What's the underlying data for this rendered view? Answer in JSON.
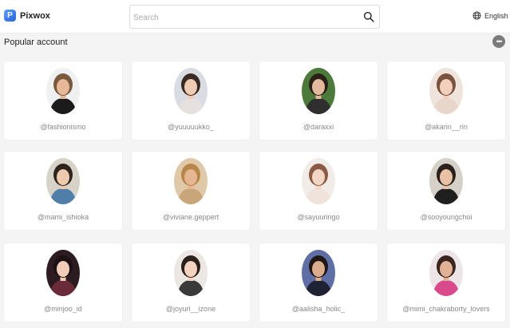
{
  "app": {
    "logo_letter": "P",
    "name": "Pixwox"
  },
  "search": {
    "placeholder": "Search",
    "value": "",
    "icon": "search-icon"
  },
  "language": {
    "label": "English",
    "icon": "globe-icon"
  },
  "section": {
    "title": "Popular account",
    "more_icon": "more-horizontal-icon",
    "more_label": "•••"
  },
  "accounts": [
    {
      "handle": "@fashionismo",
      "bg": "#eef0f2",
      "skin": "#e7b79a",
      "hair": "#7a5a3c",
      "cloth": "#1b1b1b"
    },
    {
      "handle": "@yuuuuukko_",
      "bg": "#d9dde3",
      "skin": "#f0cbb3",
      "hair": "#3a2b22",
      "cloth": "#e6e1de"
    },
    {
      "handle": "@daraxxi",
      "bg": "#4b7a3a",
      "skin": "#e2b99c",
      "hair": "#2b2018",
      "cloth": "#2f2f2f"
    },
    {
      "handle": "@akarin__rin",
      "bg": "#efe4dc",
      "skin": "#f3d0bc",
      "hair": "#7a5240",
      "cloth": "#e8d6ca"
    },
    {
      "handle": "@mami_ishioka",
      "bg": "#d7d3c8",
      "skin": "#edc9ae",
      "hair": "#2e241d",
      "cloth": "#4f7ea8"
    },
    {
      "handle": "@viviane.geppert",
      "bg": "#e0c9a8",
      "skin": "#e6b591",
      "hair": "#b7864b",
      "cloth": "#c9a57a"
    },
    {
      "handle": "@sayuuringo",
      "bg": "#f2ece8",
      "skin": "#f4d6c4",
      "hair": "#8a5a44",
      "cloth": "#f0e3dc"
    },
    {
      "handle": "@sooyoungchoi",
      "bg": "#d5d0c8",
      "skin": "#e9c2a6",
      "hair": "#2a211c",
      "cloth": "#1f1f1f"
    },
    {
      "handle": "@minjoo_id",
      "bg": "#2c1c22",
      "skin": "#f1cdb9",
      "hair": "#1c1214",
      "cloth": "#6b2a3a"
    },
    {
      "handle": "@joyuri__izone",
      "bg": "#ece7e3",
      "skin": "#f3d2bf",
      "hair": "#2b201b",
      "cloth": "#3a3a3a"
    },
    {
      "handle": "@aalisha_holic_",
      "bg": "#5f6fa6",
      "skin": "#dcac8e",
      "hair": "#1f1816",
      "cloth": "#1f2233"
    },
    {
      "handle": "@mimi_chakraborty_lovers",
      "bg": "#ece4e6",
      "skin": "#e2b296",
      "hair": "#3a2520",
      "cloth": "#d94a8c"
    }
  ]
}
